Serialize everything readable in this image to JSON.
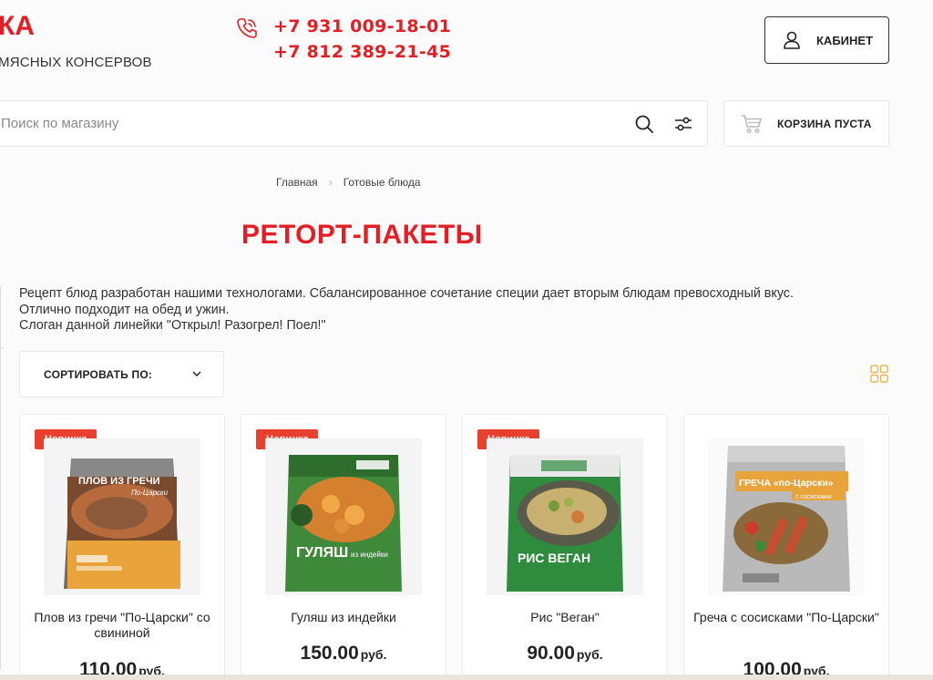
{
  "header": {
    "logo_partial": "КА",
    "tagline": "МЯСНЫХ КОНСЕРВОВ",
    "phones": [
      "+7 931 009-18-01",
      "+7 812 389-21-45"
    ],
    "cabinet_label": "КАБИНЕТ",
    "accent_color": "#e31e24"
  },
  "search": {
    "placeholder": "Поиск по магазину",
    "value": ""
  },
  "cart": {
    "label": "КОРЗИНА ПУСТА"
  },
  "breadcrumb": {
    "items": [
      "Главная",
      "Готовые блюда"
    ]
  },
  "page": {
    "title": "РЕТОРТ-ПАКЕТЫ",
    "description": [
      "Рецепт блюд разработан нашими технологами. Сбалансированное сочетание специи дает вторым блюдам превосходный вкус.",
      "Отлично подходит на обед и ужин.",
      "Слоган данной линейки \"Открыл! Разогрел! Поел!\""
    ]
  },
  "sort": {
    "label": "СОРТИРОВАТЬ ПО:"
  },
  "products": [
    {
      "badge": "Новинка",
      "name": "Плов из гречи \"По-Царски\" со свининой",
      "price": "110.00",
      "currency": "руб.",
      "pack_text": "ПЛОВ ИЗ ГРЕЧИ",
      "pack_sub": "По-Царски",
      "pack_color": "#e8a33a"
    },
    {
      "badge": "Новинка",
      "name": "Гуляш из индейки",
      "price": "150.00",
      "currency": "руб.",
      "pack_text": "ГУЛЯШ",
      "pack_sub": "из индейки",
      "pack_color": "#3f8a3a"
    },
    {
      "badge": "Новинка",
      "name": "Рис \"Веган\"",
      "price": "90.00",
      "currency": "руб.",
      "pack_text": "РИС ВЕГАН",
      "pack_sub": "",
      "pack_color": "#2f8c3f"
    },
    {
      "badge": "",
      "name": "Греча с сосисками \"По-Царски\"",
      "price": "100.00",
      "currency": "руб.",
      "pack_text": "ГРЕЧА «по-Царски»",
      "pack_sub": "с сосисками",
      "pack_color": "#b9b9b9"
    }
  ]
}
